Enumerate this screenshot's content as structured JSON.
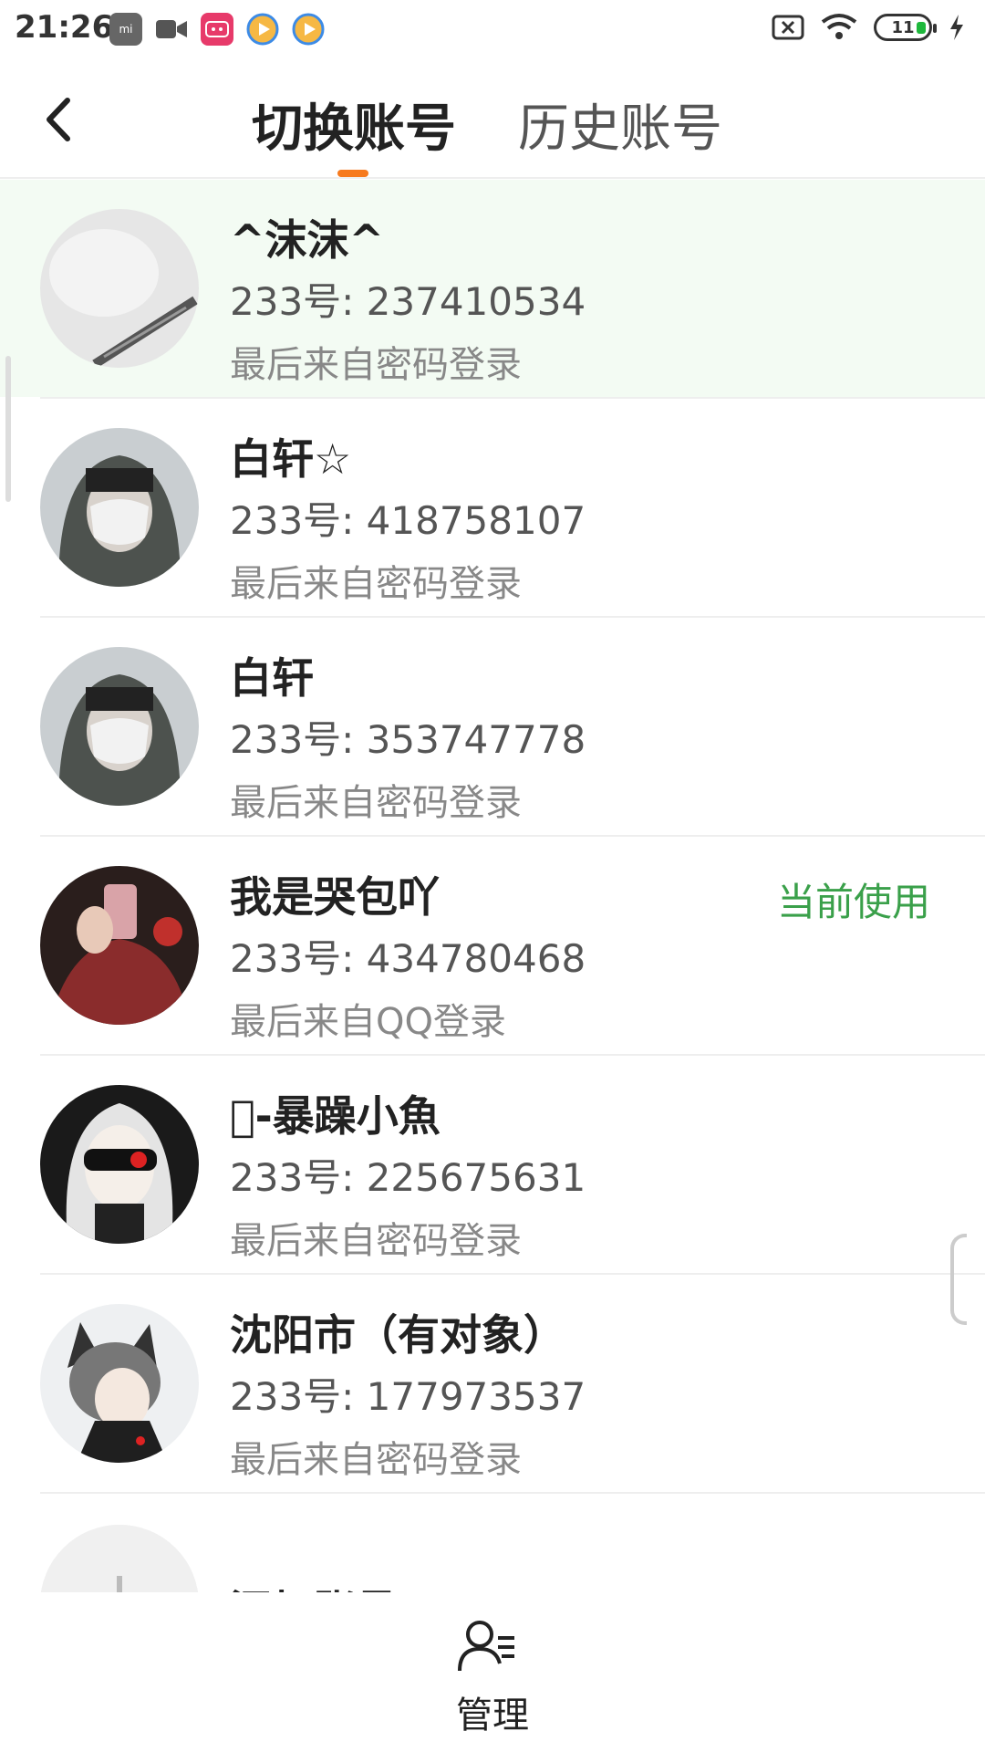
{
  "status_bar": {
    "time": "21:26",
    "battery_level": "11",
    "left_icons": [
      "mi-icon",
      "video-camera-icon",
      "bilibili-icon",
      "player-icon",
      "player-icon"
    ],
    "right_icons": [
      "sim-off-icon",
      "wifi-icon",
      "battery-icon",
      "charging-icon"
    ]
  },
  "header": {
    "back_icon": "chevron-left-icon",
    "tabs": [
      {
        "label": "切换账号",
        "active": true
      },
      {
        "label": "历史账号",
        "active": false
      }
    ],
    "accent_color": "#f77a1e"
  },
  "accounts": [
    {
      "name": "^沫沫^",
      "number": "233号: 237410534",
      "source": "最后来自密码登录",
      "current": false,
      "avatar": "avatar-guitar"
    },
    {
      "name": "白轩☆",
      "number": "233号: 418758107",
      "source": "最后来自密码登录",
      "current": false,
      "avatar": "avatar-hood-mask"
    },
    {
      "name": "白轩",
      "number": "233号: 353747778",
      "source": "最后来自密码登录",
      "current": false,
      "avatar": "avatar-hood-mask"
    },
    {
      "name": "我是哭包吖",
      "number": "233号: 434780468",
      "source": "最后来自QQ登录",
      "current": true,
      "current_label": "当前使用",
      "avatar": "avatar-mirror-selfie"
    },
    {
      "name": "\u0000-暴躁小魚",
      "number": "233号: 225675631",
      "source": "最后来自密码登录",
      "current": false,
      "avatar": "avatar-anime-mask"
    },
    {
      "name": "沈阳市（有对象）",
      "number": "233号: 177973537",
      "source": "最后来自密码登录",
      "current": false,
      "avatar": "avatar-anime-cat-ears"
    }
  ],
  "add_account": {
    "label": "添加账号"
  },
  "bottom_bar": {
    "label": "管理",
    "icon": "manage-user-icon"
  },
  "colors": {
    "current_green": "#3aa04a",
    "highlight_green": "#f3fbf3"
  }
}
